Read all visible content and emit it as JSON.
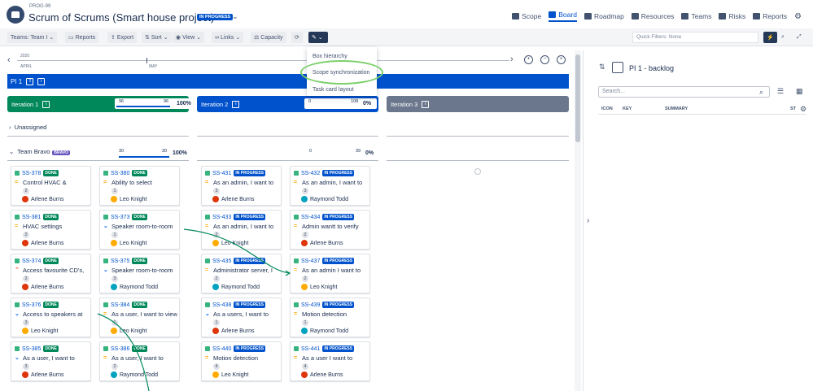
{
  "header": {
    "project_key": "PROG-99",
    "title": "Scrum of Scrums (Smart house project)",
    "status": "IN PROGRESS",
    "nav": [
      "Scope",
      "Board",
      "Roadmap",
      "Resources",
      "Teams",
      "Risks",
      "Reports"
    ]
  },
  "toolbar": {
    "teams": "Teams: Team I",
    "reports": "Reports",
    "export": "Export",
    "sort": "Sort",
    "view": "View",
    "links": "Links",
    "capacity": "Capacity",
    "quick_filters": "Quick Filters: None"
  },
  "timeline": {
    "year": "2020",
    "month1": "APRIL",
    "month2": "MAY"
  },
  "dropdown": {
    "items": [
      "Box hierarchy",
      "Scope synchronization",
      "Task card layout"
    ]
  },
  "pi": {
    "label": "PI 1"
  },
  "iterations": [
    {
      "label": "Iteration 1",
      "progress_left": "96",
      "progress_right": "96",
      "pct": "100%",
      "color": "#00875a"
    },
    {
      "label": "Iteration 2",
      "progress_left": "0",
      "progress_right": "108",
      "pct": "0%",
      "color": "#0052cc"
    },
    {
      "label": "Iteration 3",
      "color": "#6b778c"
    }
  ],
  "rows": {
    "unassigned": "Unassigned",
    "team": "Team Bravo",
    "team_badge": "BRAVO",
    "team_bar1_left": "30",
    "team_bar1_right": "30",
    "team_bar1_pct": "100%",
    "team_bar2_left": "0",
    "team_bar2_right": "39",
    "team_bar2_pct": "0%"
  },
  "cards": [
    {
      "key": "SS-378",
      "status": "DONE",
      "summary": "Control HVAC &",
      "pri": "med",
      "pts": "2",
      "assignee": "Arlene Burns",
      "av": ""
    },
    {
      "key": "SS-380",
      "status": "DONE",
      "summary": "Ability to select",
      "pri": "med",
      "pts": "1",
      "assignee": "Leo Knight",
      "av": "leo"
    },
    {
      "key": "SS-431",
      "status": "IN PROGRESS",
      "summary": "As an admin, I want to",
      "pri": "med",
      "pts": "3",
      "assignee": "Arlene Burns",
      "av": ""
    },
    {
      "key": "SS-432",
      "status": "IN PROGRESS",
      "summary": "As an admin, I want to",
      "pri": "med",
      "pts": "3",
      "assignee": "Raymond Todd",
      "av": "ray"
    },
    {
      "key": "SS-381",
      "status": "DONE",
      "summary": "HVAC settings",
      "pri": "med",
      "pts": "2",
      "assignee": "Arlene Burns",
      "av": ""
    },
    {
      "key": "SS-373",
      "status": "DONE",
      "summary": "Speaker room-to-room",
      "pri": "low",
      "pts": "1",
      "assignee": "Leo Knight",
      "av": "leo"
    },
    {
      "key": "SS-433",
      "status": "IN PROGRESS",
      "summary": "As an admin, I want to",
      "pri": "med",
      "pts": "2",
      "assignee": "Leo Knight",
      "av": "leo"
    },
    {
      "key": "SS-434",
      "status": "IN PROGRESS",
      "summary": "Admin wantt to verify",
      "pri": "med",
      "pts": "2",
      "assignee": "Arlene Burns",
      "av": ""
    },
    {
      "key": "SS-374",
      "status": "DONE",
      "summary": "Access favourite CD's,",
      "pri": "high",
      "pts": "2",
      "assignee": "Arlene Burns",
      "av": ""
    },
    {
      "key": "SS-375",
      "status": "DONE",
      "summary": "Speaker room-to-room",
      "pri": "low",
      "pts": "3",
      "assignee": "Raymond Todd",
      "av": "ray"
    },
    {
      "key": "SS-435",
      "status": "IN PROGRESS",
      "summary": "Administrator server, I",
      "pri": "med",
      "pts": "2",
      "assignee": "Raymond Todd",
      "av": "ray"
    },
    {
      "key": "SS-437",
      "status": "IN PROGRESS",
      "summary": "As an admin I want to",
      "pri": "med",
      "pts": "2",
      "assignee": "Leo Knight",
      "av": "leo"
    },
    {
      "key": "SS-376",
      "status": "DONE",
      "summary": "Access to speakers at",
      "pri": "low",
      "pts": "3",
      "assignee": "Leo Knight",
      "av": "leo"
    },
    {
      "key": "SS-384",
      "status": "DONE",
      "summary": "As a user, I want to view",
      "pri": "med",
      "pts": "1",
      "assignee": "Leo Knight",
      "av": "leo"
    },
    {
      "key": "SS-438",
      "status": "IN PROGRESS",
      "summary": "As a users, I want to",
      "pri": "low",
      "pts": "1",
      "assignee": "Arlene Burns",
      "av": ""
    },
    {
      "key": "SS-439",
      "status": "IN PROGRESS",
      "summary": "Motion detection",
      "pri": "med",
      "pts": "1",
      "assignee": "Raymond Todd",
      "av": "ray"
    },
    {
      "key": "SS-385",
      "status": "DONE",
      "summary": "As a user, I want to",
      "pri": "low",
      "pts": "3",
      "assignee": "Arlene Burns",
      "av": ""
    },
    {
      "key": "SS-386",
      "status": "DONE",
      "summary": "As a user, I want to",
      "pri": "med",
      "pts": "2",
      "assignee": "Raymond Todd",
      "av": "ray"
    },
    {
      "key": "SS-440",
      "status": "IN PROGRESS",
      "summary": "Motion detection",
      "pri": "med",
      "pts": "4",
      "assignee": "Leo Knight",
      "av": "leo"
    },
    {
      "key": "SS-441",
      "status": "IN PROGRESS",
      "summary": "As a user I want to",
      "pri": "med",
      "pts": "4",
      "assignee": "Arlene Burns",
      "av": ""
    }
  ],
  "side": {
    "title": "PI 1 - backlog",
    "search_placeholder": "Search...",
    "columns": [
      "ICON",
      "KEY",
      "SUMMARY",
      "ST"
    ]
  }
}
